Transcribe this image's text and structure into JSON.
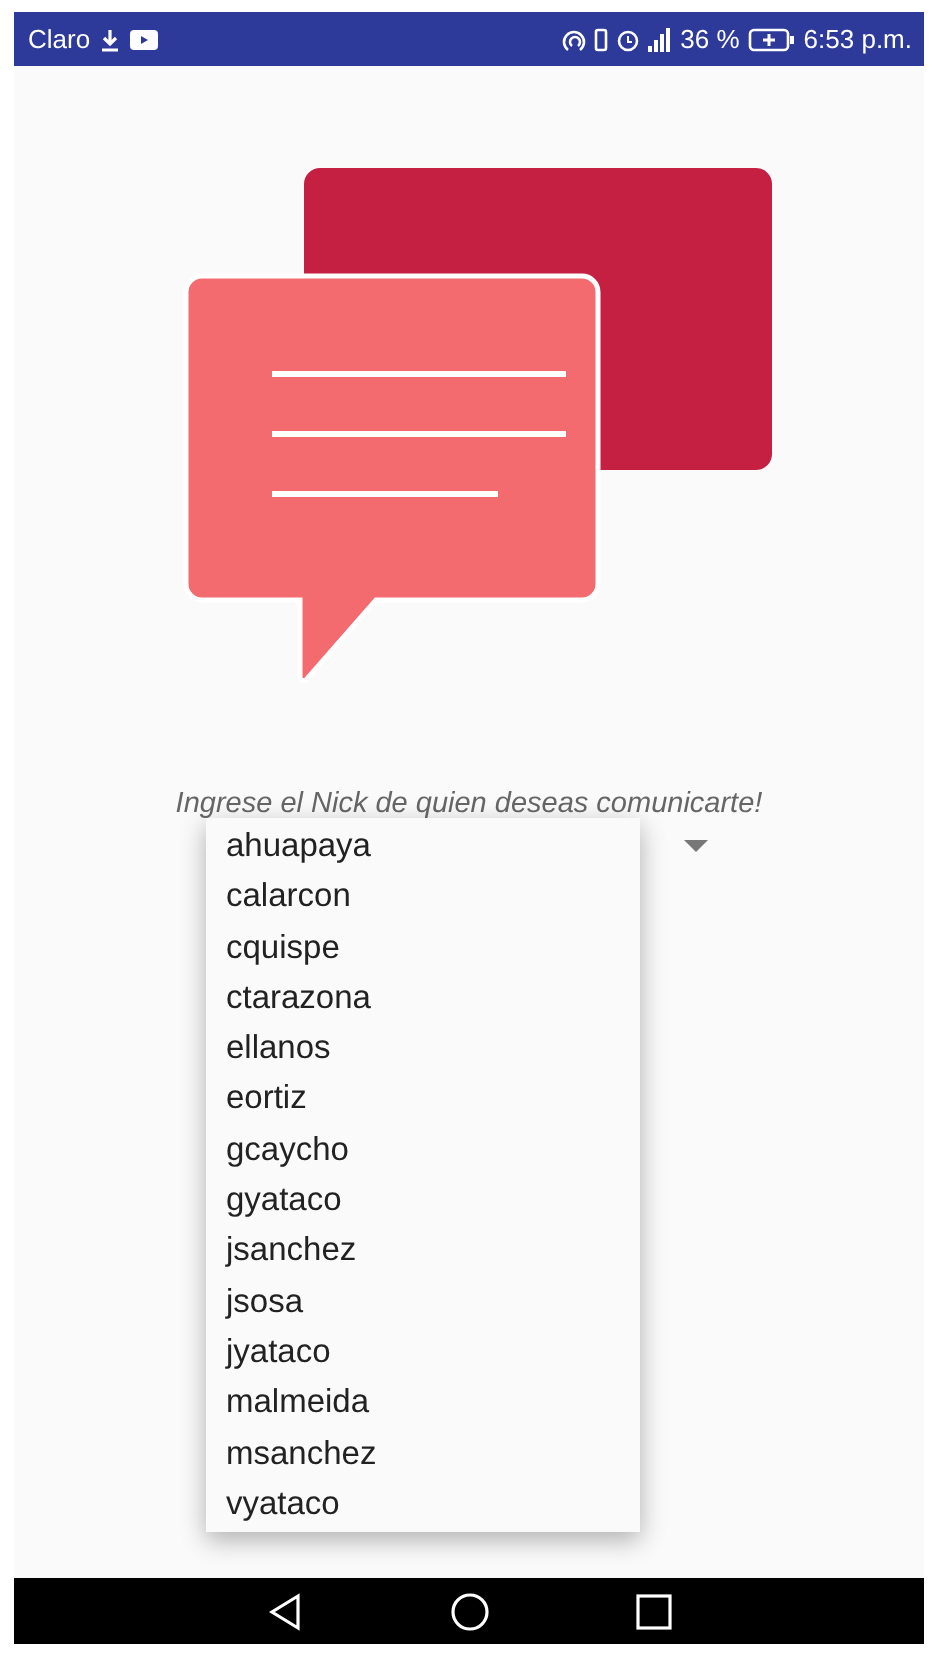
{
  "status_bar": {
    "carrier": "Claro",
    "battery": "36 %",
    "time": "6:53 p.m."
  },
  "prompt": "Ingrese el Nick de quien deseas comunicarte!",
  "dropdown": {
    "expanded": true,
    "options": [
      {
        "label": "ahuapaya"
      },
      {
        "label": "calarcon"
      },
      {
        "label": "cquispe"
      },
      {
        "label": "ctarazona"
      },
      {
        "label": "ellanos"
      },
      {
        "label": "eortiz"
      },
      {
        "label": "gcaycho"
      },
      {
        "label": "gyataco"
      },
      {
        "label": "jsanchez"
      },
      {
        "label": "jsosa"
      },
      {
        "label": "jyataco"
      },
      {
        "label": "malmeida"
      },
      {
        "label": "msanchez"
      },
      {
        "label": "vyataco"
      }
    ]
  }
}
